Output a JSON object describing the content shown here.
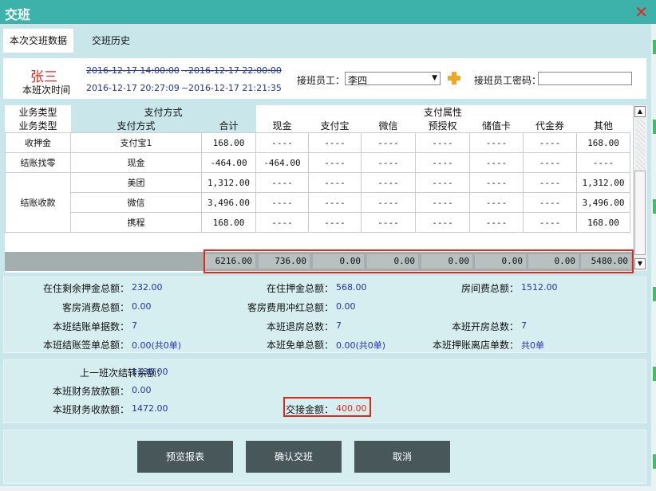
{
  "window": {
    "title": "交班"
  },
  "tabs": [
    {
      "label": "本次交班数据"
    },
    {
      "label": "交班历史"
    }
  ],
  "header": {
    "name": "张三",
    "shift_label": "本班次时间",
    "planned_start": "2016-12-17 14:00:00",
    "planned_end": "2016-12-17 22:00:00",
    "actual_start": "2016-12-17 20:27:09",
    "actual_end": "2016-12-17 21:21:35",
    "sep": "~",
    "receiver_label": "接班员工：",
    "receiver_value": "李四",
    "password_label": "接班员工密码："
  },
  "table": {
    "group_headers": {
      "type": "业务类型",
      "method": "支付方式",
      "attr": "支付属性"
    },
    "columns": [
      "业务类型",
      "支付方式",
      "合计",
      "现金",
      "支付宝",
      "微信",
      "预授权",
      "储值卡",
      "代金券",
      "其他"
    ],
    "groups": [
      {
        "type": "收押金",
        "rows": [
          [
            "支付宝1",
            "168.00",
            "----",
            "----",
            "----",
            "----",
            "----",
            "----",
            "168.00"
          ]
        ]
      },
      {
        "type": "结账找零",
        "rows": [
          [
            "现金",
            "-464.00",
            "-464.00",
            "----",
            "----",
            "----",
            "----",
            "----",
            "----"
          ]
        ]
      },
      {
        "type": "结账收款",
        "rows": [
          [
            "美团",
            "1,312.00",
            "----",
            "----",
            "----",
            "----",
            "----",
            "----",
            "1,312.00"
          ],
          [
            "微信",
            "3,496.00",
            "----",
            "----",
            "----",
            "----",
            "----",
            "----",
            "3,496.00"
          ],
          [
            "携程",
            "168.00",
            "----",
            "----",
            "----",
            "----",
            "----",
            "----",
            "168.00"
          ]
        ]
      }
    ],
    "totals": [
      "6216.00",
      "736.00",
      "0.00",
      "0.00",
      "0.00",
      "0.00",
      "0.00",
      "5480.00"
    ]
  },
  "stats": {
    "remaining_deposit_label": "在住剩余押金总额：",
    "remaining_deposit": "232.00",
    "deposit_total_label": "在住押金总额：",
    "deposit_total": "568.00",
    "room_fee_label": "房间费总额：",
    "room_fee": "1512.00",
    "consume_label": "客房消费总额：",
    "consume": "0.00",
    "offset_label": "客房费用冲红总额：",
    "offset": "0.00",
    "checkout_orders_label": "本班结账单据数：",
    "checkout_orders": "7",
    "checkout_rooms_label": "本班退房总数：",
    "checkout_rooms": "7",
    "open_rooms_label": "本班开房总数：",
    "open_rooms": "7",
    "sign_total_label": "本班结账签单总额：",
    "sign_total": "0.00(共0单)",
    "free_total_label": "本班免单总额：",
    "free_total": "0.00(共0单)",
    "credit_leave_label": "本班押账离店单数：",
    "credit_leave": "共0单"
  },
  "finance": {
    "prev_balance_label": "上一班次结转余额：",
    "prev_balance": "1136.00",
    "payout_label": "本班财务放款额：",
    "payout": "0.00",
    "income_label": "本班财务收款额：",
    "income": "1472.00",
    "handover_label": "交接金额：",
    "handover": "400.00"
  },
  "buttons": {
    "preview": "预览报表",
    "confirm": "确认交班",
    "cancel": "取消"
  },
  "colors": {
    "titlebar": "#3cb2aa",
    "accent_red": "#e5261b",
    "value_blue": "#2233aa",
    "button": "#48575a"
  }
}
